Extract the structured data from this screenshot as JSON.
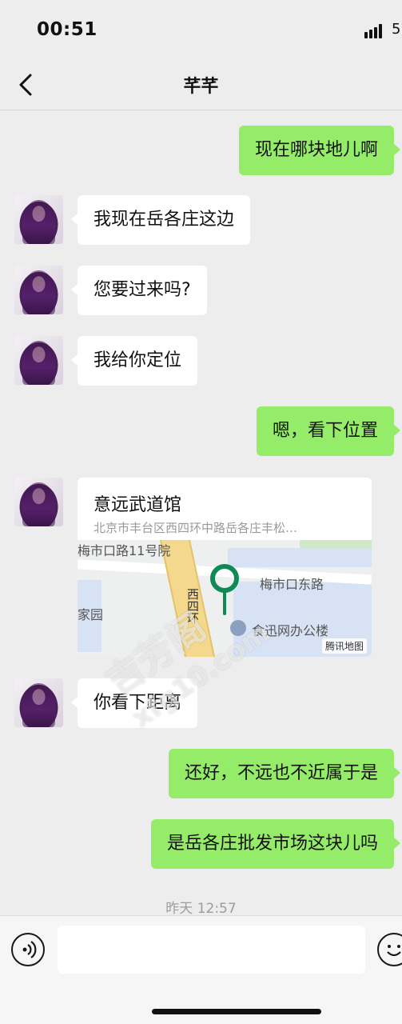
{
  "status_bar": {
    "time": "00:51",
    "extra": "5"
  },
  "header": {
    "title": "芊芊"
  },
  "messages": [
    {
      "side": "out",
      "text": "现在哪块地儿啊"
    },
    {
      "side": "in",
      "text": "我现在岳各庄这边"
    },
    {
      "side": "in",
      "text": "您要过来吗?"
    },
    {
      "side": "in",
      "text": "我给你定位"
    },
    {
      "side": "out",
      "text": "嗯，看下位置"
    },
    {
      "side": "in",
      "type": "location"
    },
    {
      "side": "in",
      "text": "你看下距离"
    },
    {
      "side": "out",
      "text": "还好，不远也不近属于是"
    },
    {
      "side": "out",
      "text": "是岳各庄批发市场这块儿吗"
    }
  ],
  "location": {
    "name": "意远武道馆",
    "address": "北京市丰台区西四环中路岳各庄丰松…",
    "map_labels": {
      "top_left": "梅市口路11号院",
      "road_right": "梅市口东路",
      "road_main": "西四环",
      "left": "家园",
      "poi": "食迅网办公楼",
      "brand": "腾讯地图"
    },
    "pin_color": "#0f8a55"
  },
  "timestamp": "昨天 12:57",
  "watermark": {
    "line1": "吉芳阁",
    "line2": "xfg10.com"
  },
  "colors": {
    "bubble_out": "#95ec69",
    "bubble_in": "#ffffff",
    "background": "#ededed"
  }
}
